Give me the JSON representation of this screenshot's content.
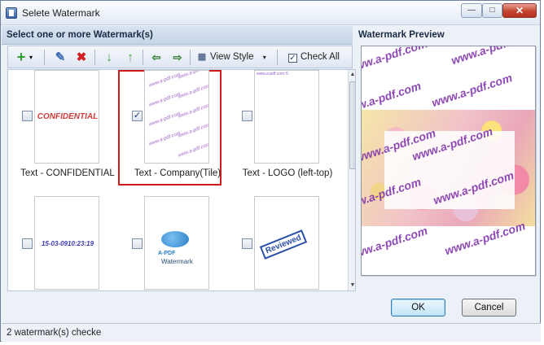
{
  "window": {
    "title": "Selete Watermark"
  },
  "list_panel": {
    "header": "Select one or more Watermark(s)"
  },
  "toolbar": {
    "view_style": "View Style",
    "check_all": "Check All",
    "check_all_checked": true
  },
  "items": [
    {
      "caption": "Text - CONFIDENTIAL",
      "checked": false,
      "thumb_text": "CONFIDENTIAL"
    },
    {
      "caption": "Text - Company(Tile)",
      "checked": true,
      "thumb_text": "www.a-pdf.com"
    },
    {
      "caption": "Text - LOGO (left-top)",
      "checked": false,
      "thumb_text": "www.a-pdf.com ©"
    },
    {
      "caption": "",
      "checked": false,
      "thumb_text": "15-03-0910:23:19"
    },
    {
      "caption": "",
      "checked": false,
      "thumb_text": "A-PDF",
      "thumb_subtext": "Watermark"
    },
    {
      "caption": "",
      "checked": false,
      "thumb_text": "Reviewed"
    }
  ],
  "preview": {
    "title": "Watermark Preview",
    "watermark_text": "www.a-pdf.com"
  },
  "buttons": {
    "ok": "OK",
    "cancel": "Cancel"
  },
  "status": {
    "text": "2 watermark(s) checke"
  },
  "colors": {
    "accent_red": "#d11a1a",
    "watermark_purple": "#7a2aa8"
  }
}
